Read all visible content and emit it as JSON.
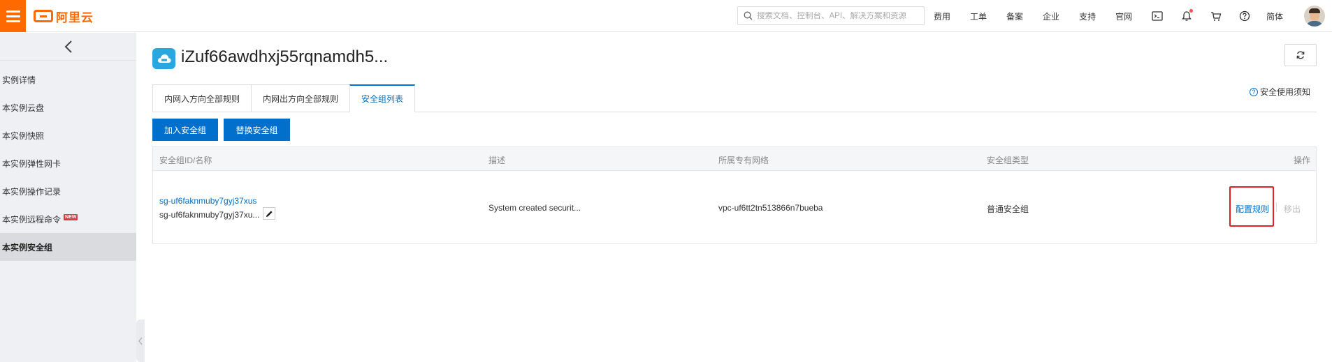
{
  "topbar": {
    "logo_text": "阿里云",
    "search_placeholder": "搜索文档、控制台、API、解决方案和资源",
    "nav": [
      "费用",
      "工单",
      "备案",
      "企业",
      "支持",
      "官网"
    ],
    "lang": "简体",
    "icons": [
      "terminal-icon",
      "bell-icon",
      "cart-icon",
      "help-icon"
    ],
    "brand_color": "#ff6a00"
  },
  "sidebar": {
    "items": [
      {
        "label": "实例详情"
      },
      {
        "label": "本实例云盘"
      },
      {
        "label": "本实例快照"
      },
      {
        "label": "本实例弹性网卡"
      },
      {
        "label": "本实例操作记录"
      },
      {
        "label": "本实例远程命令",
        "badge": "NEW"
      },
      {
        "label": "本实例安全组"
      }
    ],
    "active_index": 6
  },
  "main": {
    "title": "iZuf66awdhxj55rqnamdh5...",
    "tabs": [
      {
        "label": "内网入方向全部规则"
      },
      {
        "label": "内网出方向全部规则"
      },
      {
        "label": "安全组列表"
      }
    ],
    "active_tab": 2,
    "notice": "安全使用须知",
    "buttons": {
      "add": "加入安全组",
      "replace": "替换安全组"
    },
    "table": {
      "headers": [
        "安全组ID/名称",
        "描述",
        "所属专有网络",
        "安全组类型",
        "操作"
      ],
      "rows": [
        {
          "id": "sg-uf6faknmuby7gyj37xus",
          "name": "sg-uf6faknmuby7gyj37xu...",
          "description": "System created securit...",
          "vpc": "vpc-uf6tt2tn513866n7bueba",
          "type": "普通安全组",
          "action_primary": "配置规则",
          "action_secondary": "移出"
        }
      ]
    },
    "accent_color": "#0070cc",
    "highlight_color": "#e0212a"
  }
}
